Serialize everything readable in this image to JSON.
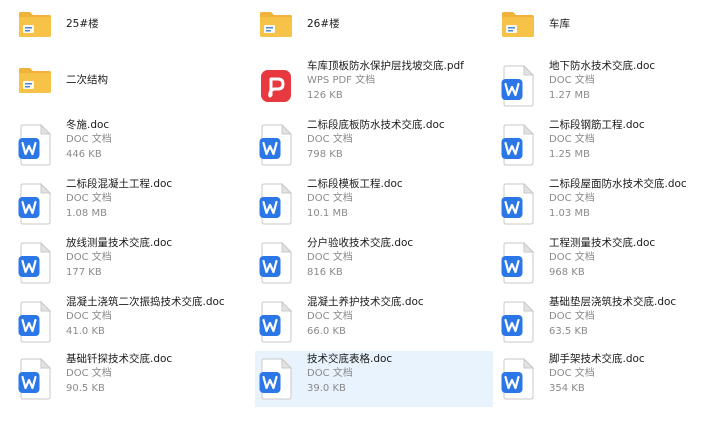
{
  "colors": {
    "folder": "#f6c247",
    "folder_back": "#f0b23a",
    "doc_blue": "#2b77e8",
    "pdf_red": "#e7393f",
    "selected_bg": "#e8f3fd"
  },
  "items": [
    {
      "name": "25#楼",
      "kind": "folder",
      "icon": "folder-icon"
    },
    {
      "name": "26#楼",
      "kind": "folder",
      "icon": "folder-icon"
    },
    {
      "name": "车库",
      "kind": "folder",
      "icon": "folder-icon"
    },
    {
      "name": "二次结构",
      "kind": "folder",
      "icon": "folder-icon"
    },
    {
      "name": "车库顶板防水保护层找坡交底.pdf",
      "kind": "pdf",
      "type_label": "WPS PDF 文档",
      "size": "126 KB",
      "icon": "pdf-icon"
    },
    {
      "name": "地下防水技术交底.doc",
      "kind": "doc",
      "type_label": "DOC 文档",
      "size": "1.27 MB",
      "icon": "word-doc-icon"
    },
    {
      "name": "冬施.doc",
      "kind": "doc",
      "type_label": "DOC 文档",
      "size": "446 KB",
      "icon": "word-doc-icon"
    },
    {
      "name": "二标段底板防水技术交底.doc",
      "kind": "doc",
      "type_label": "DOC 文档",
      "size": "798 KB",
      "icon": "word-doc-icon"
    },
    {
      "name": "二标段钢筋工程.doc",
      "kind": "doc",
      "type_label": "DOC 文档",
      "size": "1.25 MB",
      "icon": "word-doc-icon"
    },
    {
      "name": "二标段混凝土工程.doc",
      "kind": "doc",
      "type_label": "DOC 文档",
      "size": "1.08 MB",
      "icon": "word-doc-icon"
    },
    {
      "name": "二标段模板工程.doc",
      "kind": "doc",
      "type_label": "DOC 文档",
      "size": "10.1 MB",
      "icon": "word-doc-icon"
    },
    {
      "name": "二标段屋面防水技术交底.doc",
      "kind": "doc",
      "type_label": "DOC 文档",
      "size": "1.03 MB",
      "icon": "word-doc-icon"
    },
    {
      "name": "放线测量技术交底.doc",
      "kind": "doc",
      "type_label": "DOC 文档",
      "size": "177 KB",
      "icon": "word-doc-icon"
    },
    {
      "name": "分户验收技术交底.doc",
      "kind": "doc",
      "type_label": "DOC 文档",
      "size": "816 KB",
      "icon": "word-doc-icon"
    },
    {
      "name": "工程测量技术交底.doc",
      "kind": "doc",
      "type_label": "DOC 文档",
      "size": "968 KB",
      "icon": "word-doc-icon"
    },
    {
      "name": "混凝土浇筑二次振捣技术交底.doc",
      "kind": "doc",
      "type_label": "DOC 文档",
      "size": "41.0 KB",
      "icon": "word-doc-icon"
    },
    {
      "name": "混凝土养护技术交底.doc",
      "kind": "doc",
      "type_label": "DOC 文档",
      "size": "66.0 KB",
      "icon": "word-doc-icon"
    },
    {
      "name": "基础垫层浇筑技术交底.doc",
      "kind": "doc",
      "type_label": "DOC 文档",
      "size": "63.5 KB",
      "icon": "word-doc-icon"
    },
    {
      "name": "基础钎探技术交底.doc",
      "kind": "doc",
      "type_label": "DOC 文档",
      "size": "90.5 KB",
      "icon": "word-doc-icon"
    },
    {
      "name": "技术交底表格.doc",
      "kind": "doc",
      "type_label": "DOC 文档",
      "size": "39.0 KB",
      "icon": "word-doc-icon",
      "selected": true
    },
    {
      "name": "脚手架技术交底.doc",
      "kind": "doc",
      "type_label": "DOC 文档",
      "size": "354 KB",
      "icon": "word-doc-icon"
    }
  ]
}
